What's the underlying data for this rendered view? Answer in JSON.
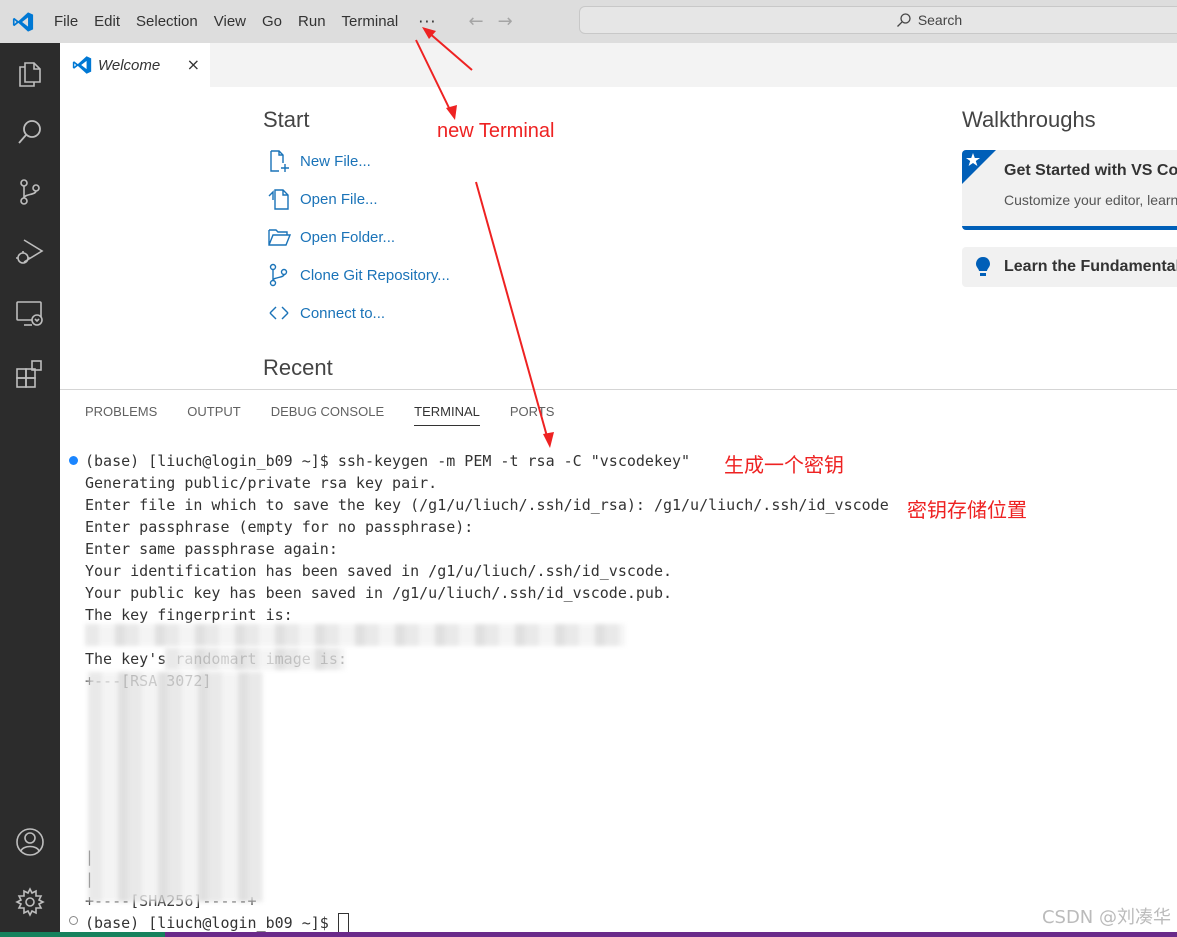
{
  "titlebar": {
    "menu": [
      "File",
      "Edit",
      "Selection",
      "View",
      "Go",
      "Run",
      "Terminal"
    ],
    "more": "···",
    "search_label": "Search"
  },
  "activitybar": {
    "icons": [
      "explorer-icon",
      "search-icon",
      "source-control-icon",
      "run-debug-icon",
      "remote-explorer-icon",
      "extensions-icon",
      "account-icon",
      "settings-gear-icon"
    ]
  },
  "tab": {
    "label": "Welcome",
    "close": "×"
  },
  "welcome": {
    "start_title": "Start",
    "start_items": [
      "New File...",
      "Open File...",
      "Open Folder...",
      "Clone Git Repository...",
      "Connect to..."
    ],
    "recent_title": "Recent",
    "walk_title": "Walkthroughs",
    "walk_card_title": "Get Started with VS Code",
    "walk_card_desc": "Customize your editor, learn the basics",
    "walk_card2_title": "Learn the Fundamentals"
  },
  "panel": {
    "tabs": [
      "PROBLEMS",
      "OUTPUT",
      "DEBUG CONSOLE",
      "TERMINAL",
      "PORTS"
    ],
    "active_tab": "TERMINAL"
  },
  "terminal": {
    "lines": [
      "(base) [liuch@login_b09 ~]$ ssh-keygen -m PEM -t rsa -C \"vscodekey\"",
      "Generating public/private rsa key pair.",
      "Enter file in which to save the key (/g1/u/liuch/.ssh/id_rsa): /g1/u/liuch/.ssh/id_vscode",
      "Enter passphrase (empty for no passphrase):",
      "Enter same passphrase again:",
      "Your identification has been saved in /g1/u/liuch/.ssh/id_vscode.",
      "Your public key has been saved in /g1/u/liuch/.ssh/id_vscode.pub.",
      "The key fingerprint is:"
    ],
    "randomart_line": "The key's randomart image is:",
    "art_top": "+---[RSA 3072]",
    "art_rows": [
      "|",
      "|"
    ],
    "art_bottom": "+----[SHA256]-----+",
    "prompt": "(base) [liuch@login_b09 ~]$ "
  },
  "annotations": {
    "new_terminal": "new Terminal",
    "gen_key": "生成一个密钥",
    "key_location": "密钥存储位置"
  },
  "watermark": "CSDN @刘凑华",
  "colors": {
    "accent": "#005fb8",
    "link": "#1a73b8",
    "annotation": "#ee2222",
    "activity_bg": "#2c2c2c"
  }
}
